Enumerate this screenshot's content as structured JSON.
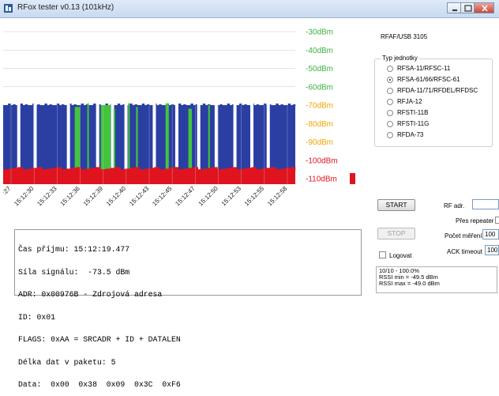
{
  "window": {
    "title": "RFox tester v0.13 (101kHz)",
    "controls": [
      "minimize",
      "maximize",
      "close"
    ]
  },
  "chart_data": {
    "type": "bar",
    "y_unit": "dBm",
    "ylim": [
      -110,
      -30
    ],
    "y_ticks": [
      "-30dBm",
      "-40dBm",
      "-50dBm",
      "-60dBm",
      "-70dBm",
      "-80dBm",
      "-90dBm",
      "-100dBm",
      "-110dBm"
    ],
    "y_tick_colors": [
      "#3cb043",
      "#3cb043",
      "#3cb043",
      "#3cb043",
      "#f0a500",
      "#f0a500",
      "#f0a500",
      "#e0141e",
      "#e0141e"
    ],
    "x_ticks": [
      ":27",
      "15:12:30",
      "15:12:33",
      "15:12:36",
      "15:12:39",
      "15:12:40",
      "15:12:43",
      "15:12:45",
      "15:12:47",
      "15:12:50",
      "15:12:53",
      "15:12:55",
      "15:12:58"
    ],
    "series_colors": {
      "noise": "#2b3fa3",
      "signal": "#43c43c",
      "floor": "#e0141e"
    },
    "noise_level": -70,
    "floor_level": -105,
    "signal_events": [
      {
        "x": 0.245,
        "w": 0.018,
        "level": -71
      },
      {
        "x": 0.288,
        "w": 0.004,
        "level": -69
      },
      {
        "x": 0.334,
        "w": 0.034,
        "level": -70
      },
      {
        "x": 0.378,
        "w": 0.004,
        "level": -72
      },
      {
        "x": 0.428,
        "w": 0.004,
        "level": -69
      },
      {
        "x": 0.455,
        "w": 0.006,
        "level": -71
      },
      {
        "x": 0.556,
        "w": 0.011,
        "level": -69
      },
      {
        "x": 0.634,
        "w": 0.012,
        "level": -72
      },
      {
        "x": 0.702,
        "w": 0.004,
        "level": -70
      }
    ],
    "gaps": [
      0.048,
      0.104,
      0.218,
      0.318,
      0.369,
      0.415,
      0.512,
      0.589,
      0.664,
      0.724,
      0.788,
      0.846,
      0.902
    ]
  },
  "log": {
    "lines": [
      "Čas příjmu: 15:12:19.477",
      "Síla signálu:  -73.5 dBm",
      "ADR: 0x00976B - Zdrojová adresa",
      "ID: 0x01",
      "FLAGS: 0xAA = SRCADR + ID + DATALEN",
      "Délka dat v paketu: 5",
      "Data:  0x00  0x38  0x09  0x3C  0xF6"
    ]
  },
  "right_panel": {
    "device": "RFAF/USB 3105",
    "group_label": "Typ jednotky",
    "unit_types": [
      {
        "label": "RFSA-11/RFSC-11",
        "selected": false
      },
      {
        "label": "RFSA-61/66/RFSC-61",
        "selected": true
      },
      {
        "label": "RFDA-11/71/RFDEL/RFDSC",
        "selected": false
      },
      {
        "label": "RFJA-12",
        "selected": false
      },
      {
        "label": "RFSTI-11B",
        "selected": false
      },
      {
        "label": "RFSTI-11G",
        "selected": false
      },
      {
        "label": "RFDA-73",
        "selected": false
      }
    ],
    "start_label": "START",
    "stop_label": "STOP",
    "rf_adr_label": "RF adr.",
    "rf_adr_value": "",
    "repeater_label": "Přes repeater",
    "count_label": "Počet měření",
    "count_value": "100",
    "ack_label": "ACK timeout",
    "ack_value": "100",
    "logovat_label": "Logovat",
    "logovat_checked": false,
    "status": [
      "10/10 - 100.0%",
      "RSSI min = -49.5 dBm",
      "RSSI max = -49.0 dBm"
    ]
  }
}
